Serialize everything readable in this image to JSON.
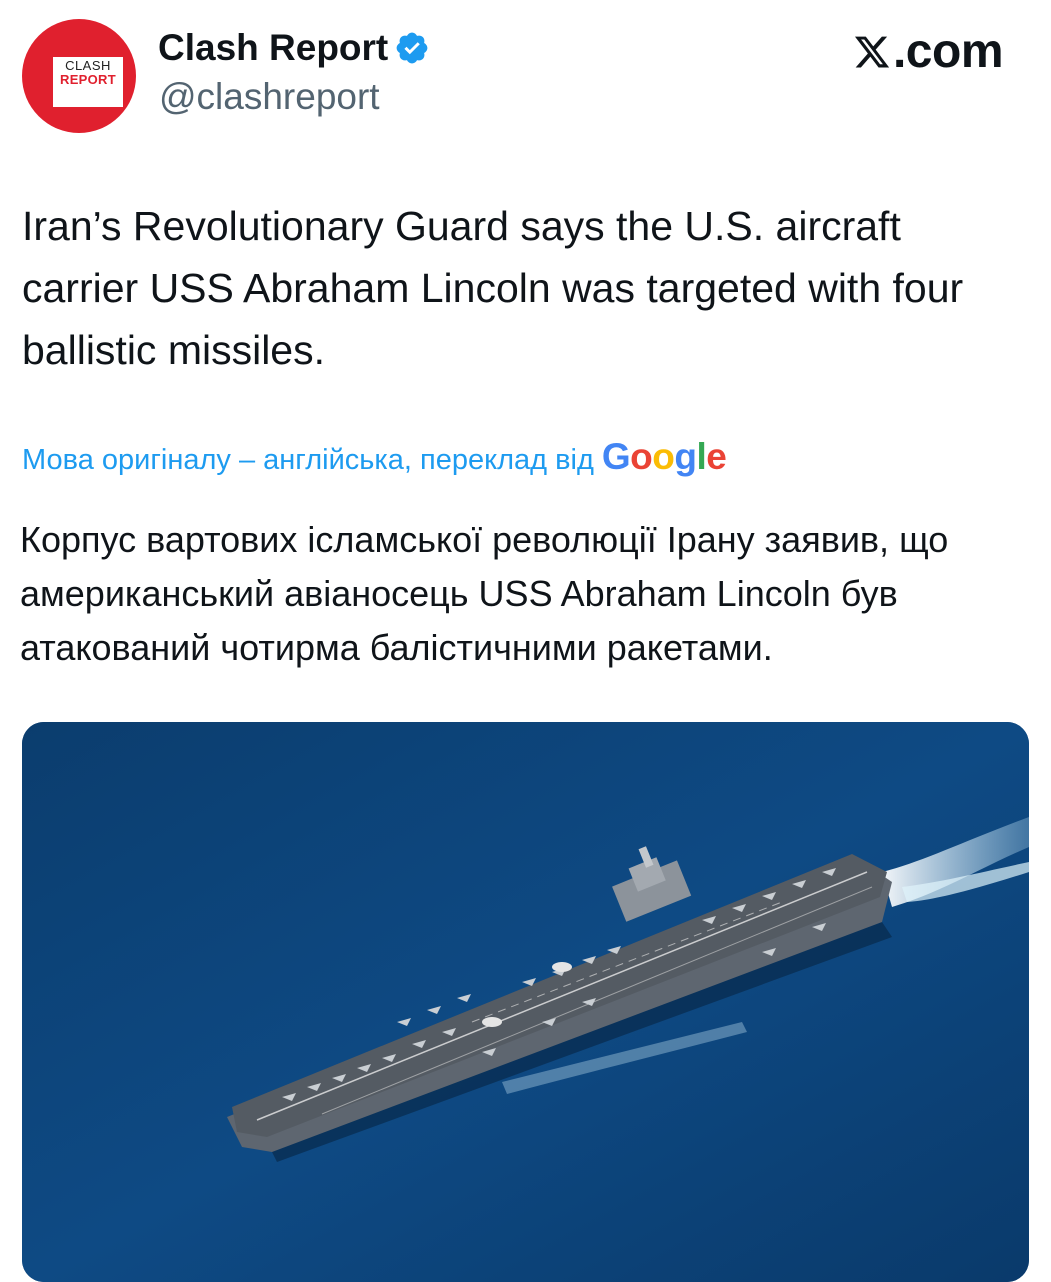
{
  "header": {
    "display_name": "Clash Report",
    "handle": "@clashreport",
    "brand": ".com",
    "avatar_line1": "CLASH",
    "avatar_line2": "REPORT"
  },
  "tweet": {
    "text": "Iran’s Revolutionary Guard says the U.S. aircraft carrier USS Abraham Lincoln was targeted with four ballistic missiles."
  },
  "translation": {
    "label": "Мова оригіналу – англійська, переклад від",
    "provider": "Google",
    "text": "Корпус вартових ісламської революції Ірану заявив, що американський авіаносець USS Abraham Lincoln був атакований чотирма балістичними ракетами."
  },
  "colors": {
    "accent": "#1d9bf0",
    "brand_red": "#e0202e",
    "sea": "#0d3f72"
  },
  "icons": {
    "verified": "verified-badge-icon",
    "x_logo": "x-logo-icon"
  }
}
